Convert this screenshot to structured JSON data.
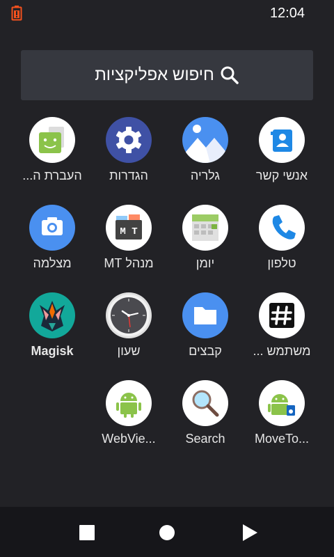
{
  "status": {
    "time": "12:04"
  },
  "search": {
    "label": "חיפוש אפליקציות"
  },
  "apps": [
    {
      "label": "אנשי קשר"
    },
    {
      "label": "גלריה"
    },
    {
      "label": "הגדרות"
    },
    {
      "label": "העברת ה..."
    },
    {
      "label": "טלפון"
    },
    {
      "label": "יומן"
    },
    {
      "label": "מנהל MT"
    },
    {
      "label": "מצלמה"
    },
    {
      "label": "משתמש ..."
    },
    {
      "label": "קבצים"
    },
    {
      "label": "שעון"
    },
    {
      "label": "Magisk"
    },
    {
      "label": "MoveTo..."
    },
    {
      "label": "Search"
    },
    {
      "label": "WebVie..."
    }
  ],
  "icons": {
    "contacts": "contacts-icon",
    "gallery": "gallery-icon",
    "settings": "settings-gear-icon",
    "migrate": "migrate-android-icon",
    "phone": "phone-icon",
    "calendar": "calendar-icon",
    "mt_manager": "mt-manager-icon",
    "camera": "camera-icon",
    "user_dictionary": "hash-icon",
    "files": "folder-icon",
    "clock": "clock-icon",
    "magisk": "magisk-icon",
    "moveto": "android-sd-icon",
    "search": "magnifier-icon",
    "webview": "android-icon"
  },
  "colors": {
    "background": "#222226",
    "search_bar": "#36383f",
    "nav_bar": "#16161a",
    "accent_blue": "#4285f4",
    "battery": "#f4511e"
  }
}
